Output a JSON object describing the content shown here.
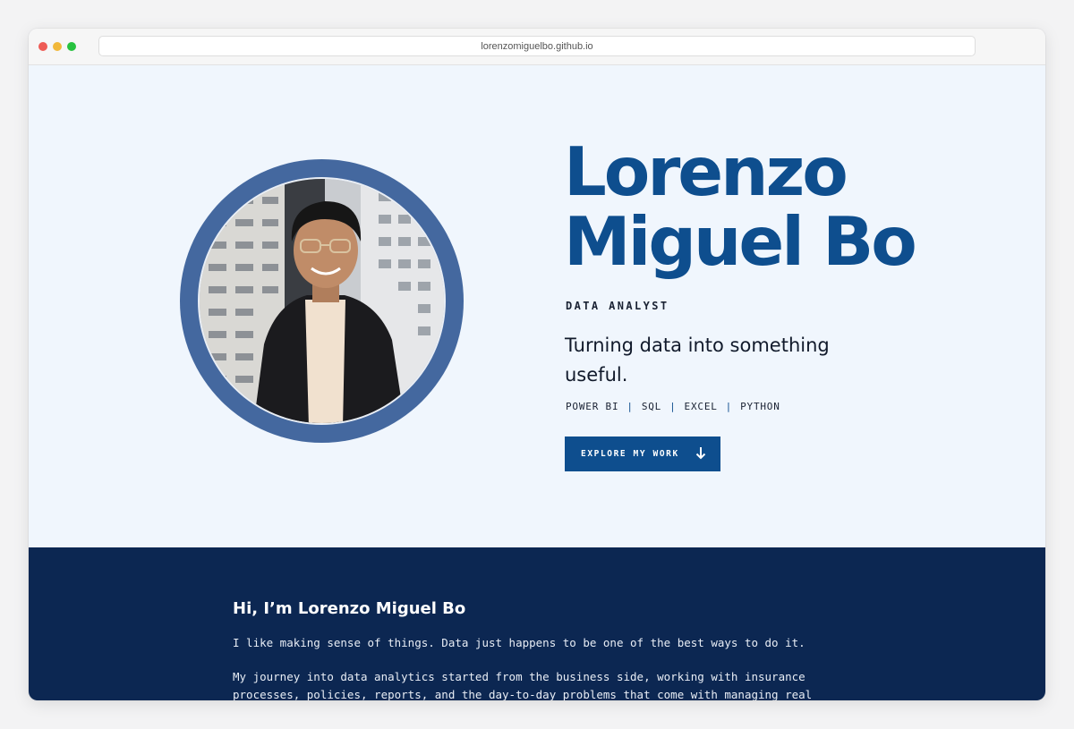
{
  "browser": {
    "url": "lorenzomiguelbo.github.io"
  },
  "hero": {
    "name_line1": "Lorenzo",
    "name_line2": "Miguel Bo",
    "role": "DATA ANALYST",
    "tagline": "Turning data into something useful.",
    "skills": [
      "POWER BI",
      "SQL",
      "EXCEL",
      "PYTHON"
    ],
    "skill_separator": "|",
    "cta_label": "EXPLORE MY WORK",
    "cta_icon": "arrow-down-icon"
  },
  "about": {
    "heading": "Hi, I’m Lorenzo Miguel Bo",
    "paragraph1": "I like making sense of things. Data just happens to be one of the best ways to do it.",
    "paragraph2": "My journey into data analytics started from the business side, working with insurance processes, policies, reports, and the day-to-day problems that come with managing real operational data."
  },
  "colors": {
    "accent": "#0e4e8e",
    "ring": "#44689f",
    "hero_bg": "#f0f6fd",
    "about_bg": "#0c2752"
  }
}
